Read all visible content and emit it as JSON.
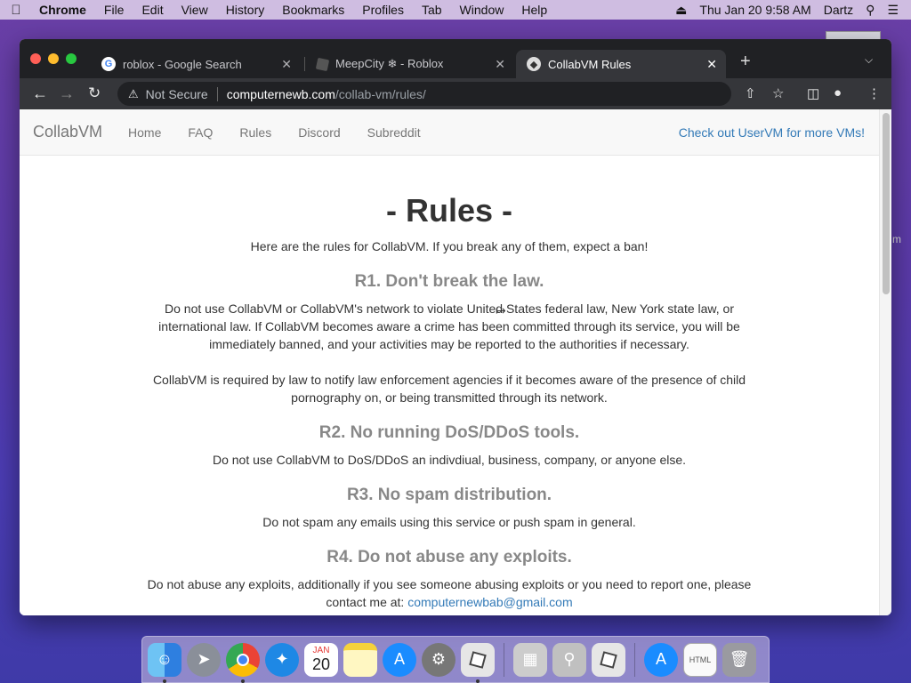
{
  "menubar": {
    "app_name": "Chrome",
    "items": [
      "File",
      "Edit",
      "View",
      "History",
      "Bookmarks",
      "Profiles",
      "Tab",
      "Window",
      "Help"
    ],
    "date_time": "Thu Jan 20  9:58 AM",
    "user": "Dartz"
  },
  "tabs": [
    {
      "title": "roblox - Google Search",
      "icon": "google-icon"
    },
    {
      "title": "MeepCity ❄ - Roblox",
      "icon": "roblox-icon"
    },
    {
      "title": "CollabVM Rules",
      "icon": "collabvm-icon",
      "active": true
    }
  ],
  "omnibox": {
    "security": "Not Secure",
    "host": "computernewb.com",
    "path": "/collab-vm/rules/"
  },
  "site_nav": {
    "brand": "CollabVM",
    "links": [
      "Home",
      "FAQ",
      "Rules",
      "Discord",
      "Subreddit"
    ],
    "right_link": "Check out UserVM for more VMs!"
  },
  "content": {
    "title": "- Rules -",
    "intro": "Here are the rules for CollabVM. If you break any of them, expect a ban!",
    "rules": [
      {
        "heading": "R1. Don't break the law.",
        "paragraphs": [
          "Do not use CollabVM or CollabVM's network to violate United States federal law, New York state law, or international law. If CollabVM becomes aware a crime has been committed through its service, you will be immediately banned, and your activities may be reported to the authorities if necessary.",
          "CollabVM is required by law to notify law enforcement agencies if it becomes aware of the presence of child pornography on, or being transmitted through its network."
        ]
      },
      {
        "heading": "R2. No running DoS/DDoS tools.",
        "paragraphs": [
          "Do not use CollabVM to DoS/DDoS an indivdiual, business, company, or anyone else."
        ]
      },
      {
        "heading": "R3. No spam distribution.",
        "paragraphs": [
          "Do not spam any emails using this service or push spam in general."
        ]
      },
      {
        "heading": "R4. Do not abuse any exploits.",
        "paragraphs": [
          "Do not abuse any exploits, additionally if you see someone abusing exploits or you need to report one, please contact me at:"
        ],
        "email": "computernewbab@gmail.com"
      }
    ]
  },
  "dock": {
    "calendar_month": "JAN",
    "calendar_day": "20"
  },
  "colors": {
    "link": "#337ab7",
    "heading_gray": "#888888",
    "tabstrip": "#202124",
    "toolbar": "#35363a"
  }
}
